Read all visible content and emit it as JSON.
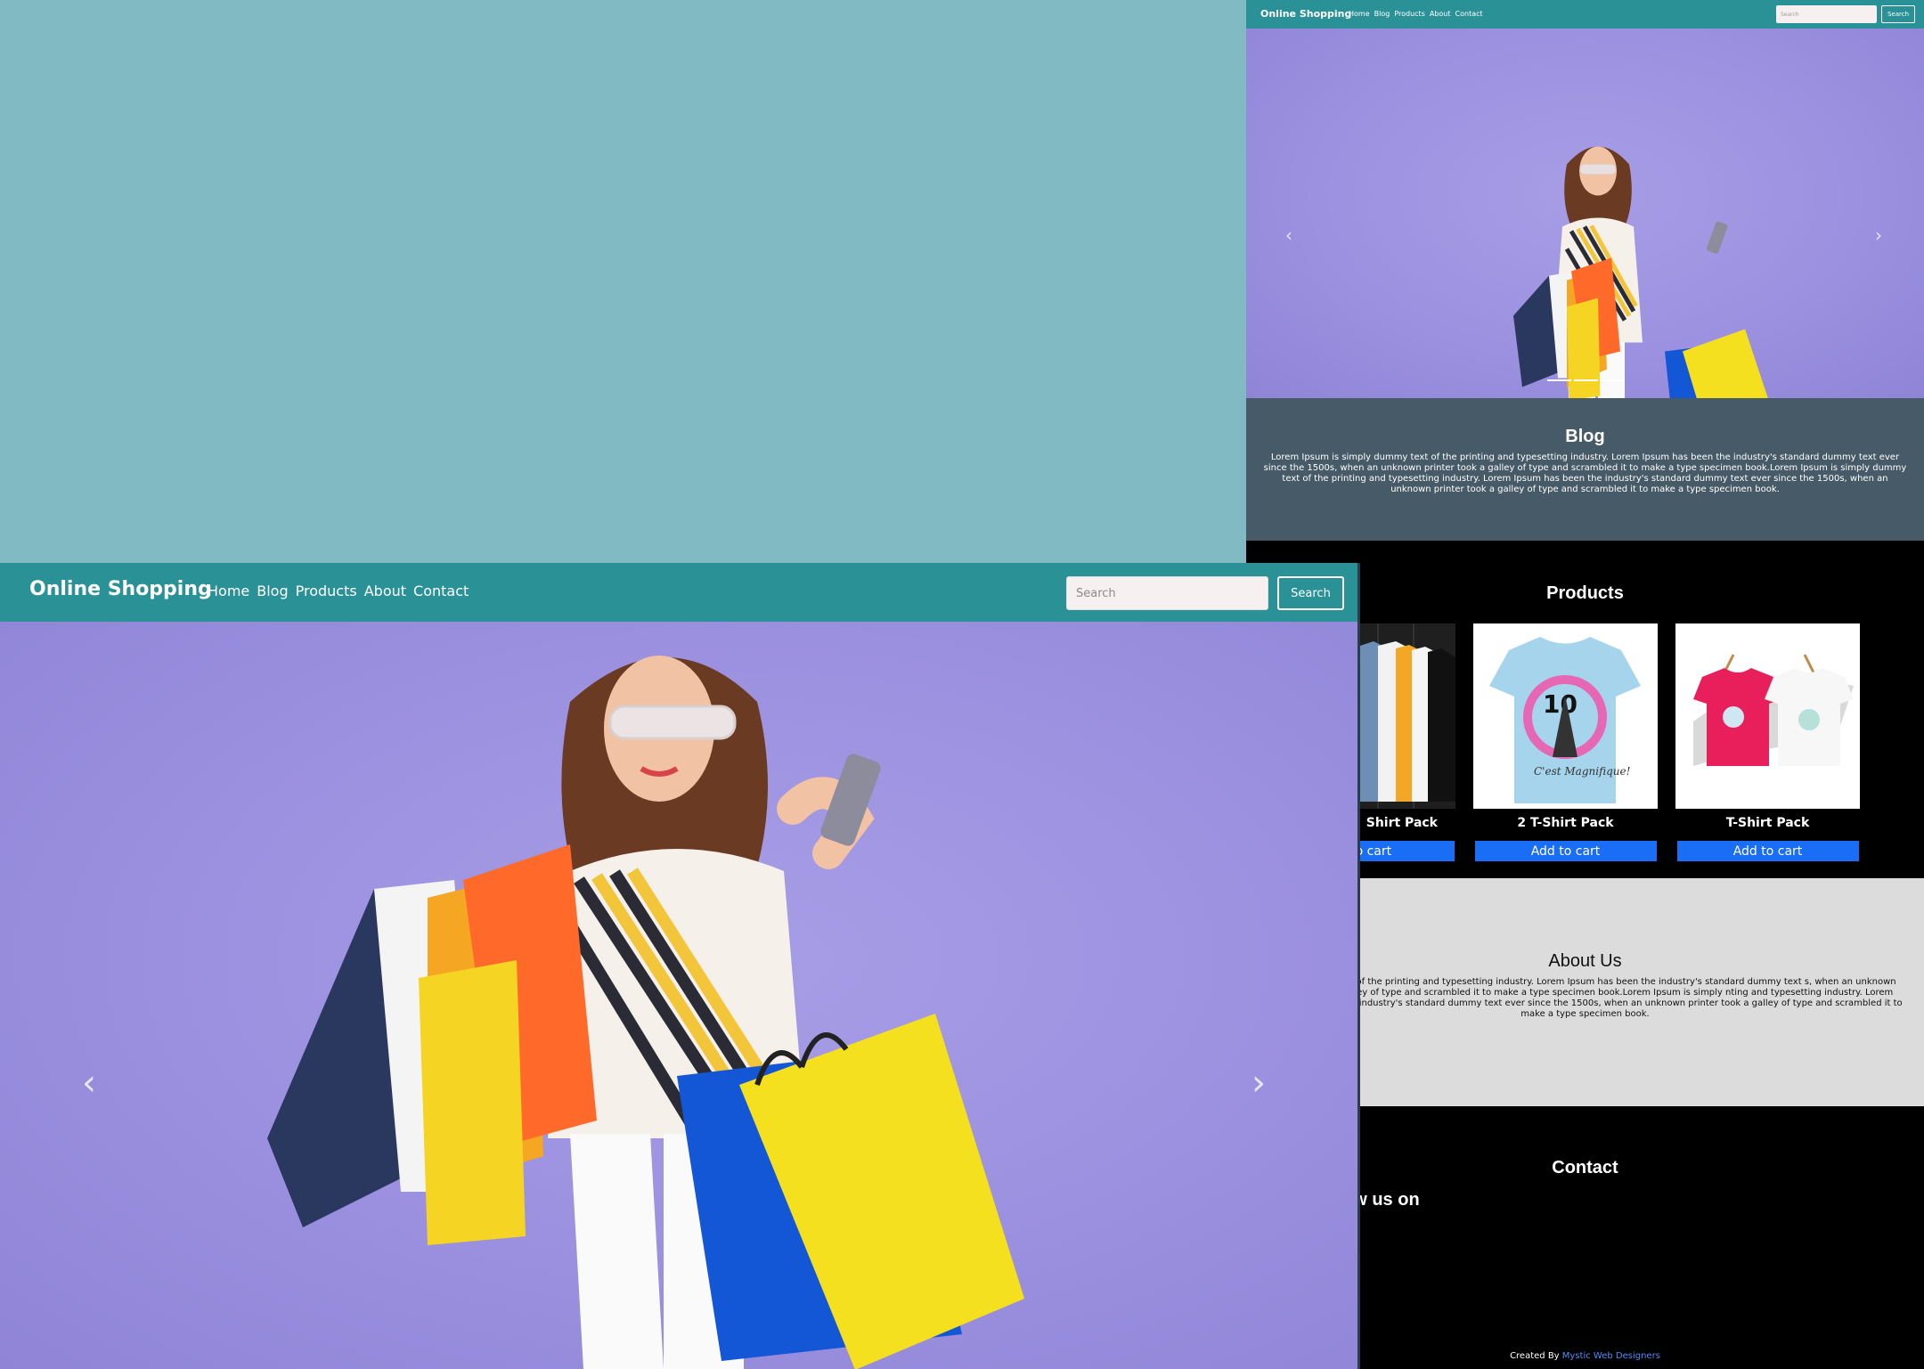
{
  "colors": {
    "desktop": "#81bac2",
    "nav": "#2a9196",
    "hero": "#9e94e0",
    "blog": "#475a67",
    "about": "#dcdcdc",
    "button": "#1a6ef5",
    "link": "#4f8cff"
  },
  "front": {
    "brand": "Online Shopping",
    "nav": [
      "Home",
      "Blog",
      "Products",
      "About",
      "Contact"
    ],
    "search_placeholder": "Search",
    "search_button": "Search",
    "carousel": {
      "prev": "‹",
      "next": "›",
      "indicators": 3
    }
  },
  "back": {
    "brand": "Online Shopping",
    "nav": [
      "Home",
      "Blog",
      "Products",
      "About",
      "Contact"
    ],
    "search_placeholder": "Search",
    "search_button": "Search",
    "carousel": {
      "prev": "‹",
      "next": "›",
      "indicators": 3
    },
    "blog": {
      "title": "Blog",
      "text": "Lorem Ipsum is simply dummy text of the printing and typesetting industry. Lorem Ipsum has been the industry's standard dummy text ever since the 1500s, when an unknown printer took a galley of type and scrambled it to make a type specimen book.Lorem Ipsum is simply dummy text of the printing and typesetting industry. Lorem Ipsum has been the industry's standard dummy text ever since the 1500s, when an unknown printer took a galley of type and scrambled it to make a type specimen book."
    },
    "products": {
      "title": "Products",
      "items": [
        {
          "name": "Shirt Pack",
          "button": "ld to cart"
        },
        {
          "name": "2 T-Shirt Pack",
          "button": "Add to cart"
        },
        {
          "name": "T-Shirt Pack",
          "button": "Add to cart"
        }
      ]
    },
    "about": {
      "title": "About Us",
      "text": "mply dummy text of the printing and typesetting industry. Lorem Ipsum has been the industry's standard dummy text s, when an unknown printer took a galley of type and scrambled it to make a type specimen book.Lorem Ipsum is simply nting and typesetting industry. Lorem Ipsum has been the industry's standard dummy text ever since the 1500s, when an unknown printer took a galley of type and scrambled it to make a type specimen book."
    },
    "contact": {
      "title": "Contact",
      "follow": "ow us on"
    },
    "footer": {
      "prefix": "Created By",
      "link": "Mystic Web Designers"
    }
  }
}
